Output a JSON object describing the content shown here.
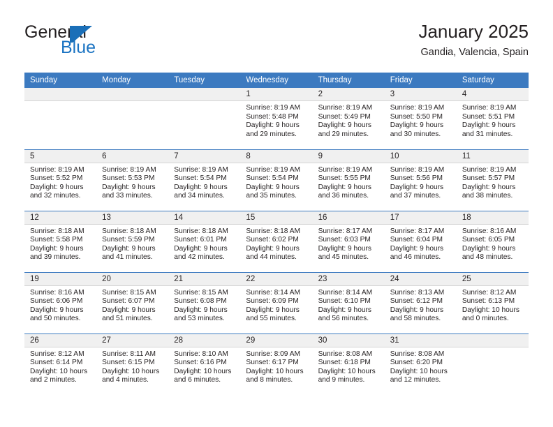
{
  "brand": {
    "name_top": "General",
    "name_bottom": "Blue",
    "accent_color": "#1a6fb8"
  },
  "header": {
    "title": "January 2025",
    "subtitle": "Gandia, Valencia, Spain"
  },
  "theme": {
    "header_blue": "#3c7ac0",
    "daynum_band": "#f0f0f0",
    "text": "#231f20"
  },
  "calendar": {
    "weekday_headers": [
      "Sunday",
      "Monday",
      "Tuesday",
      "Wednesday",
      "Thursday",
      "Friday",
      "Saturday"
    ],
    "weeks": [
      [
        {
          "empty": true
        },
        {
          "empty": true
        },
        {
          "empty": true
        },
        {
          "day": "1",
          "sunrise": "Sunrise: 8:19 AM",
          "sunset": "Sunset: 5:48 PM",
          "daylight1": "Daylight: 9 hours",
          "daylight2": "and 29 minutes."
        },
        {
          "day": "2",
          "sunrise": "Sunrise: 8:19 AM",
          "sunset": "Sunset: 5:49 PM",
          "daylight1": "Daylight: 9 hours",
          "daylight2": "and 29 minutes."
        },
        {
          "day": "3",
          "sunrise": "Sunrise: 8:19 AM",
          "sunset": "Sunset: 5:50 PM",
          "daylight1": "Daylight: 9 hours",
          "daylight2": "and 30 minutes."
        },
        {
          "day": "4",
          "sunrise": "Sunrise: 8:19 AM",
          "sunset": "Sunset: 5:51 PM",
          "daylight1": "Daylight: 9 hours",
          "daylight2": "and 31 minutes."
        }
      ],
      [
        {
          "day": "5",
          "sunrise": "Sunrise: 8:19 AM",
          "sunset": "Sunset: 5:52 PM",
          "daylight1": "Daylight: 9 hours",
          "daylight2": "and 32 minutes."
        },
        {
          "day": "6",
          "sunrise": "Sunrise: 8:19 AM",
          "sunset": "Sunset: 5:53 PM",
          "daylight1": "Daylight: 9 hours",
          "daylight2": "and 33 minutes."
        },
        {
          "day": "7",
          "sunrise": "Sunrise: 8:19 AM",
          "sunset": "Sunset: 5:54 PM",
          "daylight1": "Daylight: 9 hours",
          "daylight2": "and 34 minutes."
        },
        {
          "day": "8",
          "sunrise": "Sunrise: 8:19 AM",
          "sunset": "Sunset: 5:54 PM",
          "daylight1": "Daylight: 9 hours",
          "daylight2": "and 35 minutes."
        },
        {
          "day": "9",
          "sunrise": "Sunrise: 8:19 AM",
          "sunset": "Sunset: 5:55 PM",
          "daylight1": "Daylight: 9 hours",
          "daylight2": "and 36 minutes."
        },
        {
          "day": "10",
          "sunrise": "Sunrise: 8:19 AM",
          "sunset": "Sunset: 5:56 PM",
          "daylight1": "Daylight: 9 hours",
          "daylight2": "and 37 minutes."
        },
        {
          "day": "11",
          "sunrise": "Sunrise: 8:19 AM",
          "sunset": "Sunset: 5:57 PM",
          "daylight1": "Daylight: 9 hours",
          "daylight2": "and 38 minutes."
        }
      ],
      [
        {
          "day": "12",
          "sunrise": "Sunrise: 8:18 AM",
          "sunset": "Sunset: 5:58 PM",
          "daylight1": "Daylight: 9 hours",
          "daylight2": "and 39 minutes."
        },
        {
          "day": "13",
          "sunrise": "Sunrise: 8:18 AM",
          "sunset": "Sunset: 5:59 PM",
          "daylight1": "Daylight: 9 hours",
          "daylight2": "and 41 minutes."
        },
        {
          "day": "14",
          "sunrise": "Sunrise: 8:18 AM",
          "sunset": "Sunset: 6:01 PM",
          "daylight1": "Daylight: 9 hours",
          "daylight2": "and 42 minutes."
        },
        {
          "day": "15",
          "sunrise": "Sunrise: 8:18 AM",
          "sunset": "Sunset: 6:02 PM",
          "daylight1": "Daylight: 9 hours",
          "daylight2": "and 44 minutes."
        },
        {
          "day": "16",
          "sunrise": "Sunrise: 8:17 AM",
          "sunset": "Sunset: 6:03 PM",
          "daylight1": "Daylight: 9 hours",
          "daylight2": "and 45 minutes."
        },
        {
          "day": "17",
          "sunrise": "Sunrise: 8:17 AM",
          "sunset": "Sunset: 6:04 PM",
          "daylight1": "Daylight: 9 hours",
          "daylight2": "and 46 minutes."
        },
        {
          "day": "18",
          "sunrise": "Sunrise: 8:16 AM",
          "sunset": "Sunset: 6:05 PM",
          "daylight1": "Daylight: 9 hours",
          "daylight2": "and 48 minutes."
        }
      ],
      [
        {
          "day": "19",
          "sunrise": "Sunrise: 8:16 AM",
          "sunset": "Sunset: 6:06 PM",
          "daylight1": "Daylight: 9 hours",
          "daylight2": "and 50 minutes."
        },
        {
          "day": "20",
          "sunrise": "Sunrise: 8:15 AM",
          "sunset": "Sunset: 6:07 PM",
          "daylight1": "Daylight: 9 hours",
          "daylight2": "and 51 minutes."
        },
        {
          "day": "21",
          "sunrise": "Sunrise: 8:15 AM",
          "sunset": "Sunset: 6:08 PM",
          "daylight1": "Daylight: 9 hours",
          "daylight2": "and 53 minutes."
        },
        {
          "day": "22",
          "sunrise": "Sunrise: 8:14 AM",
          "sunset": "Sunset: 6:09 PM",
          "daylight1": "Daylight: 9 hours",
          "daylight2": "and 55 minutes."
        },
        {
          "day": "23",
          "sunrise": "Sunrise: 8:14 AM",
          "sunset": "Sunset: 6:10 PM",
          "daylight1": "Daylight: 9 hours",
          "daylight2": "and 56 minutes."
        },
        {
          "day": "24",
          "sunrise": "Sunrise: 8:13 AM",
          "sunset": "Sunset: 6:12 PM",
          "daylight1": "Daylight: 9 hours",
          "daylight2": "and 58 minutes."
        },
        {
          "day": "25",
          "sunrise": "Sunrise: 8:12 AM",
          "sunset": "Sunset: 6:13 PM",
          "daylight1": "Daylight: 10 hours",
          "daylight2": "and 0 minutes."
        }
      ],
      [
        {
          "day": "26",
          "sunrise": "Sunrise: 8:12 AM",
          "sunset": "Sunset: 6:14 PM",
          "daylight1": "Daylight: 10 hours",
          "daylight2": "and 2 minutes."
        },
        {
          "day": "27",
          "sunrise": "Sunrise: 8:11 AM",
          "sunset": "Sunset: 6:15 PM",
          "daylight1": "Daylight: 10 hours",
          "daylight2": "and 4 minutes."
        },
        {
          "day": "28",
          "sunrise": "Sunrise: 8:10 AM",
          "sunset": "Sunset: 6:16 PM",
          "daylight1": "Daylight: 10 hours",
          "daylight2": "and 6 minutes."
        },
        {
          "day": "29",
          "sunrise": "Sunrise: 8:09 AM",
          "sunset": "Sunset: 6:17 PM",
          "daylight1": "Daylight: 10 hours",
          "daylight2": "and 8 minutes."
        },
        {
          "day": "30",
          "sunrise": "Sunrise: 8:08 AM",
          "sunset": "Sunset: 6:18 PM",
          "daylight1": "Daylight: 10 hours",
          "daylight2": "and 9 minutes."
        },
        {
          "day": "31",
          "sunrise": "Sunrise: 8:08 AM",
          "sunset": "Sunset: 6:20 PM",
          "daylight1": "Daylight: 10 hours",
          "daylight2": "and 12 minutes."
        },
        {
          "empty": true
        }
      ]
    ]
  }
}
